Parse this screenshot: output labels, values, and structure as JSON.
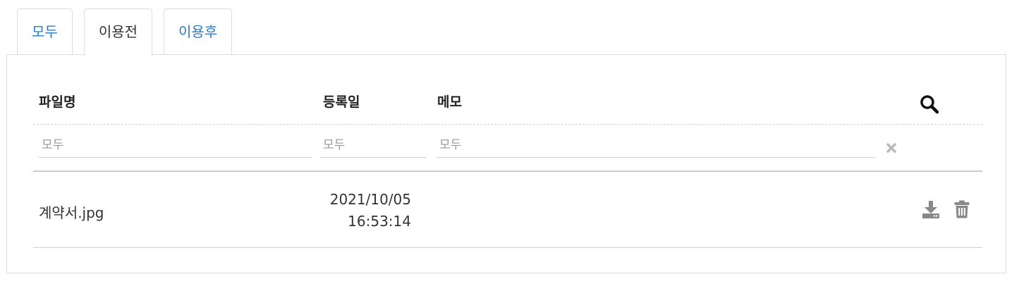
{
  "tabs": [
    {
      "label": "모두",
      "active": false
    },
    {
      "label": "이용전",
      "active": true
    },
    {
      "label": "이용후",
      "active": false
    }
  ],
  "table": {
    "headers": {
      "file_name": "파일명",
      "registered_date": "등록일",
      "memo": "메모"
    },
    "filters": {
      "file_name_placeholder": "모두",
      "registered_date_placeholder": "모두",
      "memo_placeholder": "모두"
    },
    "rows": [
      {
        "file_name": "계약서.jpg",
        "registered_date": "2021/10/05",
        "registered_time": "16:53:14",
        "memo": ""
      }
    ]
  },
  "icons": {
    "search": "search-icon",
    "clear": "close-icon",
    "download": "download-icon",
    "delete": "trash-icon"
  },
  "colors": {
    "tab_link": "#2a7ac7",
    "border": "#dddddd",
    "icon_gray": "#888888"
  }
}
